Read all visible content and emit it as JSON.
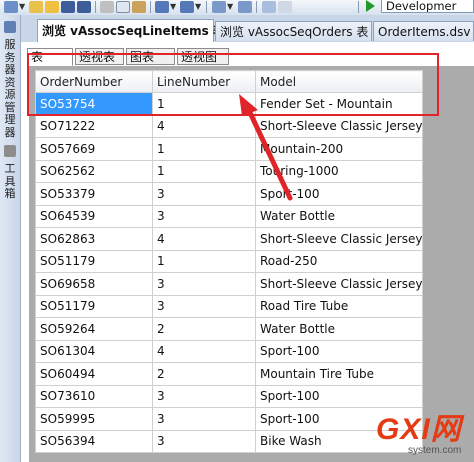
{
  "toolbar": {
    "config_value": "Developmer"
  },
  "left_panel": {
    "server_explorer_label": "服务器资源管理器",
    "toolbox_label": "工具箱"
  },
  "doc_tabs": [
    {
      "label": "浏览 vAssocSeqLineItems 表",
      "active": true
    },
    {
      "label": "浏览 vAssocSeqOrders 表",
      "active": false
    },
    {
      "label": "OrderItems.dsv",
      "active": false
    }
  ],
  "view_tabs": [
    {
      "label": "表",
      "active": true
    },
    {
      "label": "透视表",
      "active": false
    },
    {
      "label": "图表",
      "active": false
    },
    {
      "label": "透视图",
      "active": false
    }
  ],
  "table": {
    "columns": [
      "OrderNumber",
      "LineNumber",
      "Model"
    ],
    "rows": [
      [
        "SO53754",
        "1",
        "Fender Set - Mountain"
      ],
      [
        "SO71222",
        "4",
        "Short-Sleeve Classic Jersey"
      ],
      [
        "SO57669",
        "1",
        "Mountain-200"
      ],
      [
        "SO62562",
        "1",
        "Touring-1000"
      ],
      [
        "SO53379",
        "3",
        "Sport-100"
      ],
      [
        "SO64539",
        "3",
        "Water Bottle"
      ],
      [
        "SO62863",
        "4",
        "Short-Sleeve Classic Jersey"
      ],
      [
        "SO51179",
        "1",
        "Road-250"
      ],
      [
        "SO69658",
        "3",
        "Short-Sleeve Classic Jersey"
      ],
      [
        "SO51179",
        "3",
        "Road Tire Tube"
      ],
      [
        "SO59264",
        "2",
        "Water Bottle"
      ],
      [
        "SO61304",
        "4",
        "Sport-100"
      ],
      [
        "SO60494",
        "2",
        "Mountain Tire Tube"
      ],
      [
        "SO73610",
        "3",
        "Sport-100"
      ],
      [
        "SO59995",
        "3",
        "Sport-100"
      ],
      [
        "SO56394",
        "3",
        "Bike Wash"
      ]
    ],
    "selected_row": 0
  },
  "watermark": {
    "brand": "GXI网",
    "url": "system.com"
  },
  "colors": {
    "annotation": "#e0242a",
    "selection": "#3399ff"
  }
}
